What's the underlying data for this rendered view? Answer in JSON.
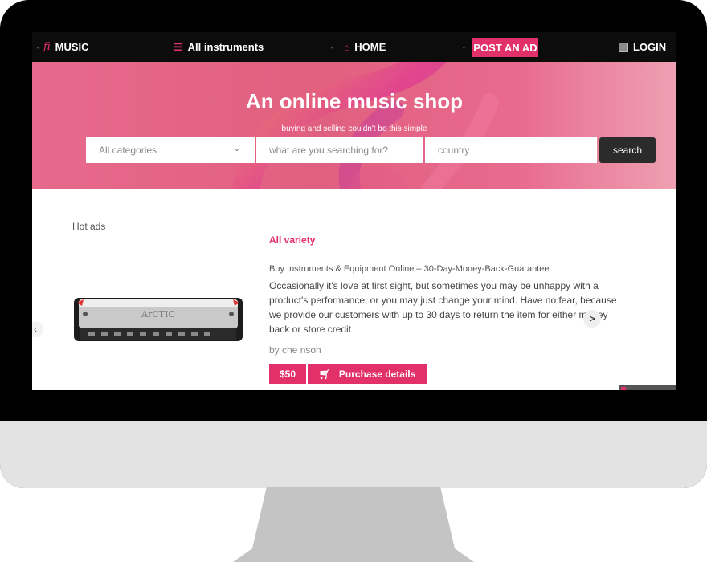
{
  "navbar": {
    "brand_logo": "fi",
    "brand": "MUSIC",
    "instruments": "All instruments",
    "home": "HOME",
    "post_ad": "POST AN AD",
    "login": "LOGIN"
  },
  "hero": {
    "title": "An online music shop",
    "subtitle": "buying and selling couldn't be this simple"
  },
  "search": {
    "category_selected": "All categories",
    "query_placeholder": "what are you searching for?",
    "country_placeholder": "country",
    "button": "search"
  },
  "hot_ads": {
    "heading": "Hot ads",
    "category": "All variety",
    "title": "Buy Instruments & Equipment Online – 30-Day-Money-Back-Guarantee",
    "description": "Occasionally it's love at first sight, but sometimes you may be unhappy with a product's performance, or you may just change your mind. Have no fear, because we provide our customers with up to 30 days to return the item for either money back or store credit",
    "author": "by che nsoh",
    "price": "$50",
    "purchase_label": "Purchase details",
    "product_brand": "ArCTIC",
    "carousel_prev": "‹",
    "carousel_next": ">"
  },
  "colors": {
    "accent": "#e2306a",
    "navbar": "#0c0c0c",
    "hero": "#e0607f",
    "search_button": "#2b2b2b"
  }
}
